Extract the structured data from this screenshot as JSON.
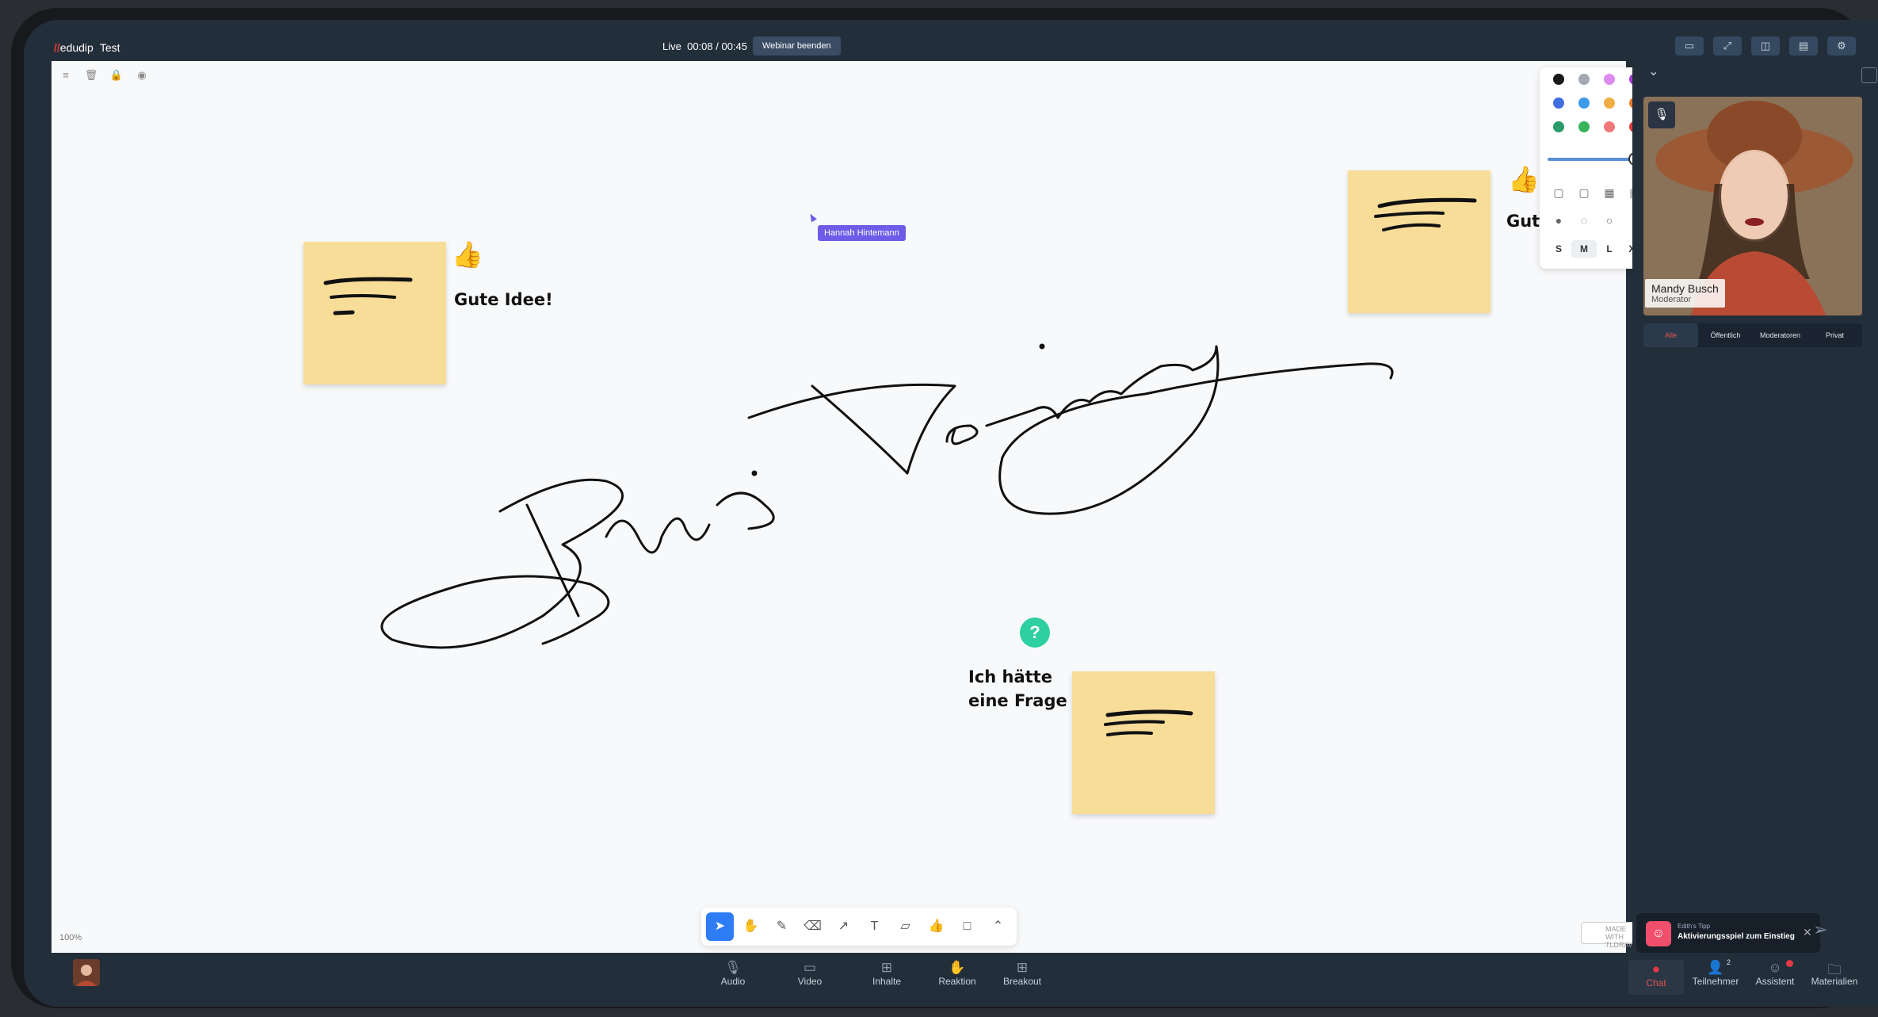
{
  "app": {
    "brand": "edudip",
    "title": "Test"
  },
  "header": {
    "live_label": "Live",
    "timer": "00:08 / 00:45",
    "end_button": "Webinar beenden"
  },
  "canvas": {
    "zoom": "100%",
    "cursor_user": "Hannah Hintemann",
    "notes": {
      "gute_idee": "Gute Idee!",
      "gute_partial": "Gut",
      "frage_line1": "Ich hätte",
      "frage_line2": "eine Frage"
    },
    "handwriting": "Brainstorming",
    "style_panel": {
      "colors": [
        "#1a1a1a",
        "#a4a9b0",
        "#dc8bf0",
        "#a63ed6",
        "#3f6ee0",
        "#3b9bea",
        "#f0ad42",
        "#ea7a26",
        "#2a9b6a",
        "#38b45e",
        "#f0787a",
        "#e23b3b"
      ],
      "sizes": [
        "S",
        "M",
        "L",
        "XL"
      ],
      "selected_size": "M",
      "opacity": 1.0
    },
    "tldraw_badge": "MADE WITH TLDRAW"
  },
  "sidebar": {
    "participant_name": "Mandy Busch",
    "participant_role": "Moderator",
    "tabs": [
      "Alle",
      "Öffentlich",
      "Moderatoren",
      "Privat"
    ],
    "tip_header": "Edith's Tipp",
    "tip_text": "Aktivierungsspiel zum Einstieg"
  },
  "bottombar": {
    "audio": "Audio",
    "video": "Video",
    "inhalte": "Inhalte",
    "reaktion": "Reaktion",
    "breakout": "Breakout",
    "chat": "Chat",
    "teilnehmer": "Teilnehmer",
    "teilnehmer_count": "2",
    "assistent": "Assistent",
    "materialien": "Materialien"
  }
}
